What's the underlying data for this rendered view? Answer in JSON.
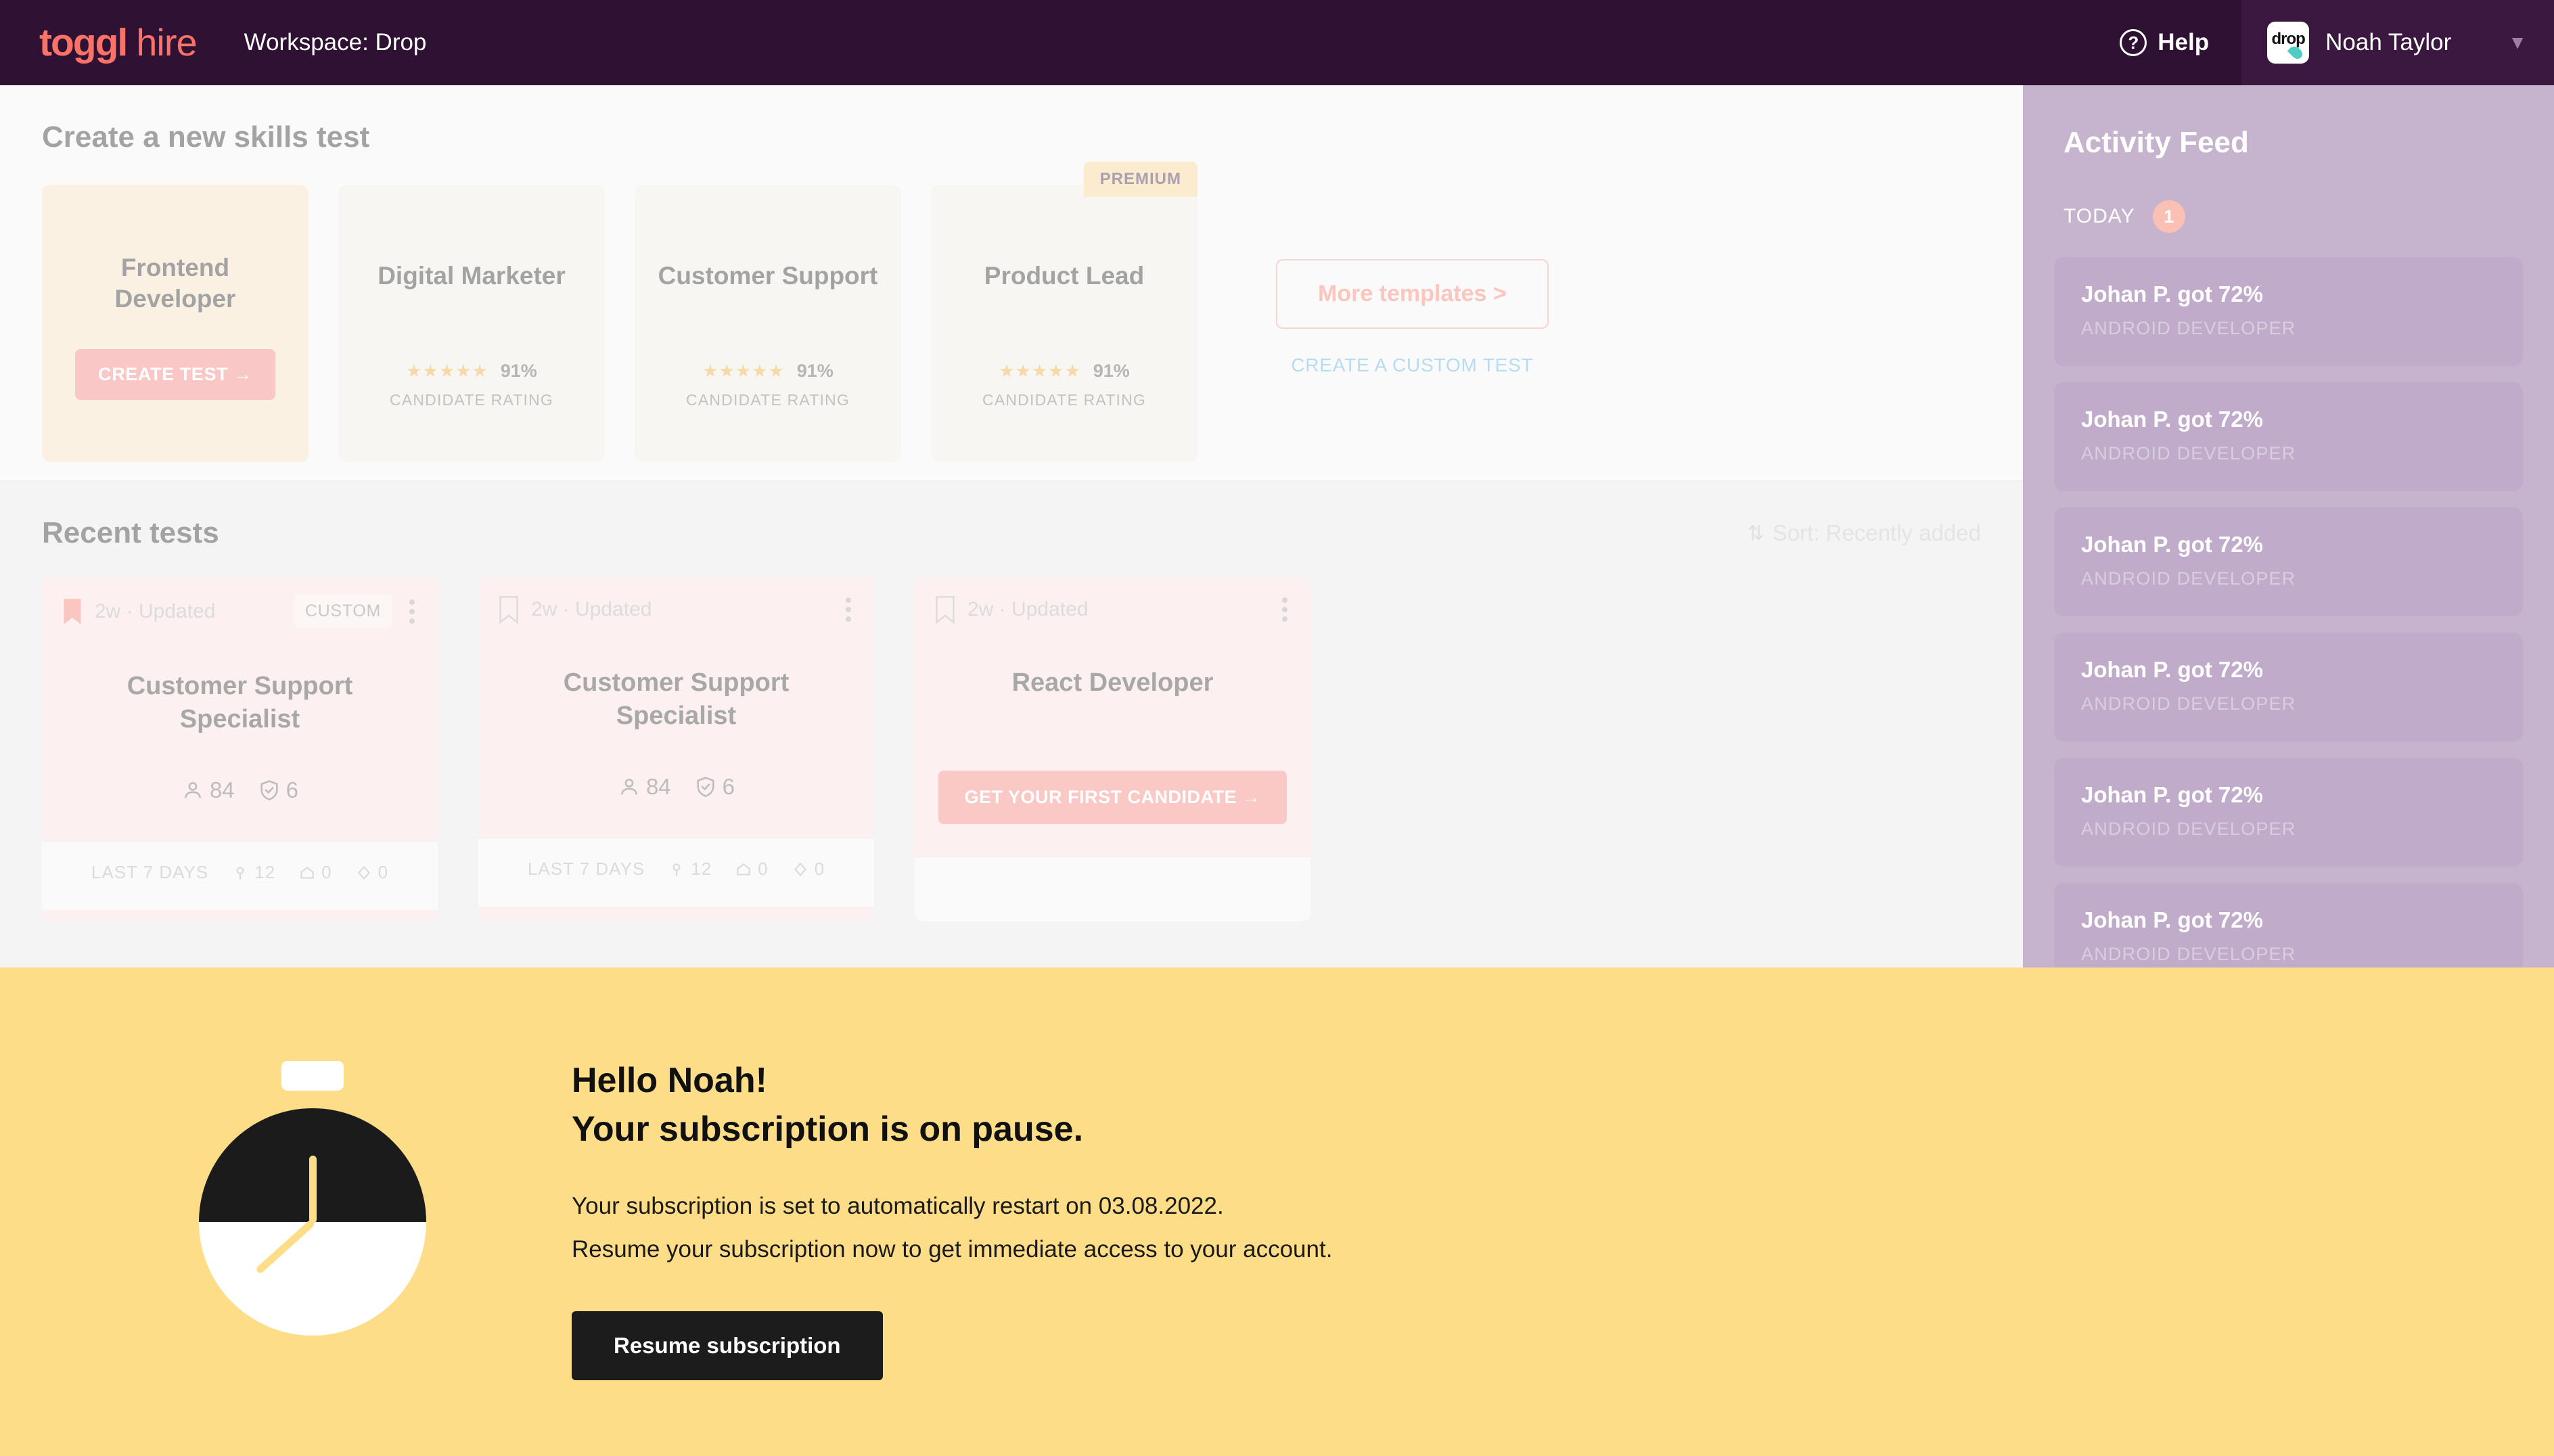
{
  "topbar": {
    "logo_primary": "toggl",
    "logo_secondary": "hire",
    "workspace": "Workspace: Drop",
    "help_label": "Help",
    "help_icon_glyph": "?",
    "avatar_text": "drop",
    "user_name": "Noah Taylor",
    "caret_glyph": "▼",
    "bg_color": "#2f1233",
    "accent_color": "#fa7268"
  },
  "create_section": {
    "title": "Create a new skills test",
    "templates": [
      {
        "name": "Frontend Developer",
        "hovered": true,
        "cta_label": "CREATE TEST →",
        "premium": false,
        "rating_pct": "",
        "rating_label": "",
        "stars": ""
      },
      {
        "name": "Digital Marketer",
        "hovered": false,
        "cta_label": "",
        "premium": false,
        "rating_pct": "91%",
        "rating_label": "CANDIDATE RATING",
        "stars": "★★★★★"
      },
      {
        "name": "Customer Support",
        "hovered": false,
        "cta_label": "",
        "premium": false,
        "rating_pct": "91%",
        "rating_label": "CANDIDATE RATING",
        "stars": "★★★★★"
      },
      {
        "name": "Product Lead",
        "hovered": false,
        "cta_label": "",
        "premium": true,
        "premium_label": "PREMIUM",
        "rating_pct": "91%",
        "rating_label": "CANDIDATE RATING",
        "stars": "★★★★★"
      }
    ],
    "more_templates_label": "More templates >",
    "custom_test_label": "CREATE A CUSTOM TEST"
  },
  "recent_section": {
    "title": "Recent tests",
    "sort_label": "Sort: Recently added",
    "sort_icon": "⇅",
    "cards": [
      {
        "meta": "2w · Updated",
        "bookmark": "filled",
        "tag": "CUSTOM",
        "title": "Customer Support Specialist",
        "candidates": "84",
        "shortlisted": "6",
        "footer_label": "LAST 7 DAYS",
        "footer_views": "12",
        "footer_starts": "0",
        "footer_finishes": "0",
        "cta_label": ""
      },
      {
        "meta": "2w · Updated",
        "bookmark": "outline",
        "tag": "",
        "title": "Customer Support Specialist",
        "candidates": "84",
        "shortlisted": "6",
        "footer_label": "LAST 7 DAYS",
        "footer_views": "12",
        "footer_starts": "0",
        "footer_finishes": "0",
        "cta_label": ""
      },
      {
        "meta": "2w · Updated",
        "bookmark": "outline",
        "tag": "",
        "title": "React Developer",
        "candidates": "",
        "shortlisted": "",
        "footer_label": "",
        "footer_views": "",
        "footer_starts": "",
        "footer_finishes": "",
        "cta_label": "GET YOUR FIRST CANDIDATE →"
      }
    ]
  },
  "activity_feed": {
    "title": "Activity Feed",
    "today_label": "TODAY",
    "today_count": "1",
    "items": [
      {
        "title": "Johan P. got 72%",
        "subtitle": "ANDROID DEVELOPER"
      },
      {
        "title": "Johan P. got 72%",
        "subtitle": "ANDROID DEVELOPER"
      },
      {
        "title": "Johan P. got 72%",
        "subtitle": "ANDROID DEVELOPER"
      },
      {
        "title": "Johan P. got 72%",
        "subtitle": "ANDROID DEVELOPER"
      },
      {
        "title": "Johan P. got 72%",
        "subtitle": "ANDROID DEVELOPER"
      },
      {
        "title": "Johan P. got 72%",
        "subtitle": "ANDROID DEVELOPER"
      }
    ],
    "bg_color": "#c6b4cf"
  },
  "banner": {
    "greeting": "Hello Noah!",
    "headline": "Your subscription is on pause.",
    "body_line1": "Your subscription is set to automatically restart on 03.08.2022.",
    "body_line2": "Resume your subscription now to get immediate access to your account.",
    "cta_label": "Resume subscription",
    "bg_color": "#fddd87"
  }
}
